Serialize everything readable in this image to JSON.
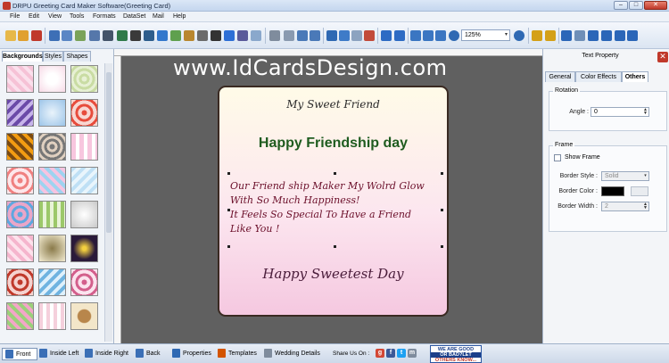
{
  "window": {
    "title": "DRPU Greeting Card Maker Software(Greeting Card)",
    "minimize_label": "–",
    "maximize_label": "□",
    "close_label": "✕"
  },
  "menu": [
    "File",
    "Edit",
    "View",
    "Tools",
    "Formats",
    "DataSet",
    "Mail",
    "Help"
  ],
  "toolbar": {
    "zoom_value": "125%",
    "zoom_caret": "▾"
  },
  "left_panel": {
    "tabs": [
      "Backgrounds",
      "Styles",
      "Shapes"
    ]
  },
  "watermark": "www.IdCardsDesign.com",
  "card": {
    "heading": "My Sweet Friend",
    "title": "Happy Friendship day",
    "body_lines": [
      "Our Friend ship Maker My Wolrd Glow",
      "With So Much Happiness!",
      "It Feels So Special To Have a Friend",
      "Like You !"
    ],
    "footer": "Happy Sweetest Day",
    "colors": {
      "heading": "#2a2a2a",
      "title": "#1f5c1f",
      "body": "#6b0f2a",
      "footer": "#4a1c3a"
    }
  },
  "right_panel": {
    "title": "Text Property",
    "close_label": "✕",
    "tabs": [
      "General",
      "Color Effects",
      "Others"
    ],
    "rotation": {
      "group_label": "Rotation",
      "angle_label": "Angle :",
      "angle_value": "0"
    },
    "frame": {
      "group_label": "Frame",
      "show_frame_label": "Show Frame",
      "border_style_label": "Border Style :",
      "border_style_value": "Solid",
      "border_color_label": "Border Color :",
      "border_width_label": "Border Width :",
      "border_width_value": "2",
      "border_color": "#000000"
    }
  },
  "statusbar": {
    "items": [
      "Front",
      "Inside Left",
      "Inside Right",
      "Back",
      "Properties",
      "Templates",
      "Wedding Details"
    ],
    "share_label": "Share Us On :",
    "social": [
      "g",
      "f",
      "t",
      "m"
    ],
    "badge_lines": [
      "WE ARE GOOD",
      "OR BAD?LET",
      "OTHERS KNOW..."
    ]
  },
  "colors": {
    "accent": "#c0392b",
    "canvas": "#606060",
    "panel": "#f1f4f8"
  }
}
